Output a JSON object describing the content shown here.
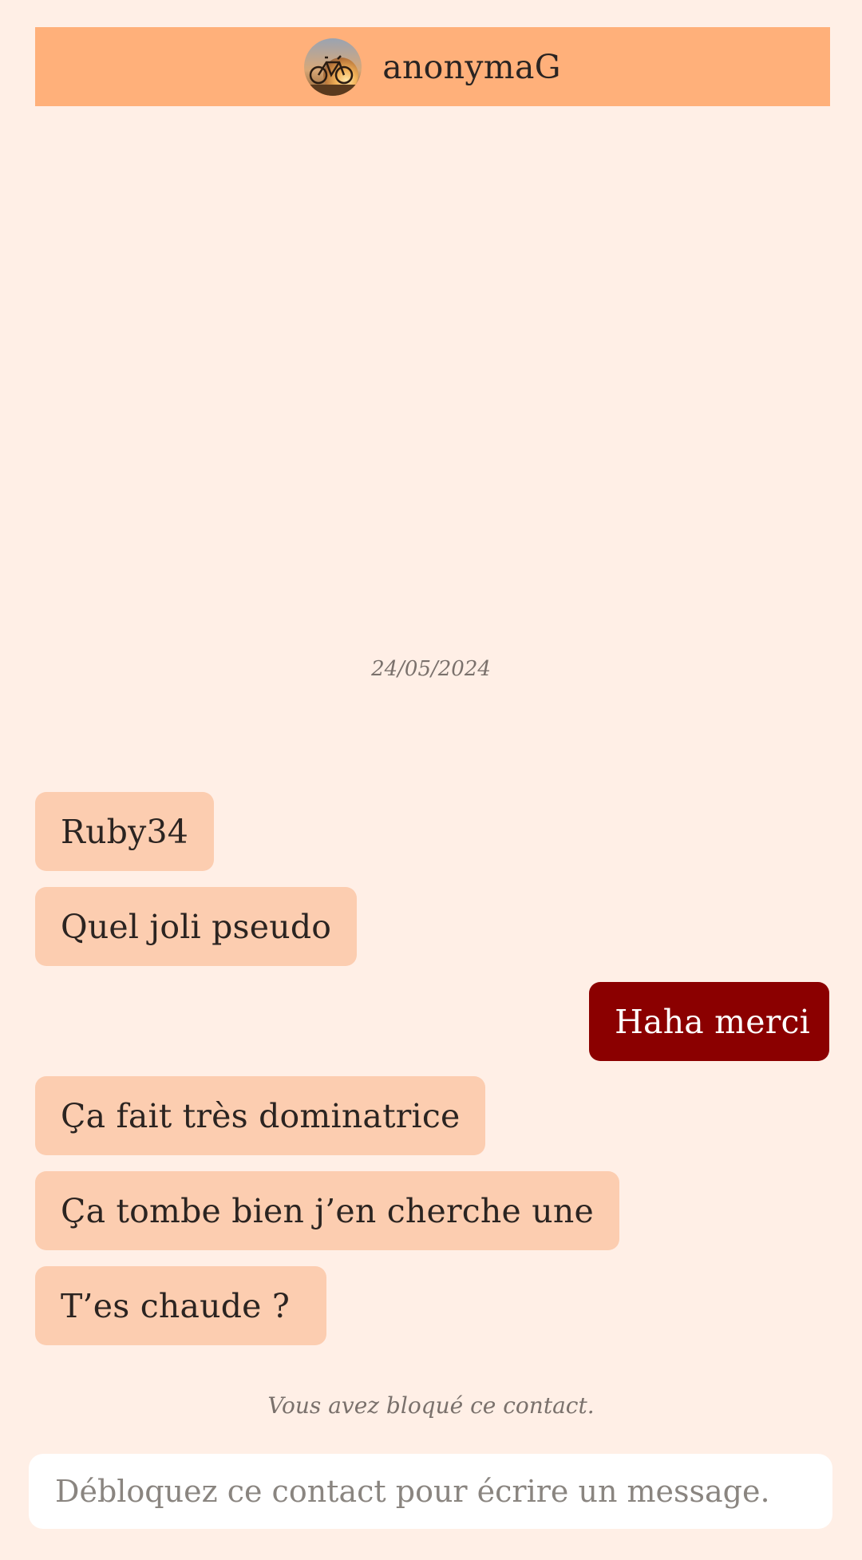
{
  "header": {
    "contact_name": "anonymaG",
    "avatar_icon": "bicycle-sunset-avatar"
  },
  "conversation": {
    "date": "24/05/2024",
    "messages": [
      {
        "direction": "incoming",
        "text": "Ruby34"
      },
      {
        "direction": "incoming",
        "text": "Quel joli pseudo"
      },
      {
        "direction": "outgoing",
        "text": "Haha merci"
      },
      {
        "direction": "incoming",
        "text": "Ça fait très dominatrice"
      },
      {
        "direction": "incoming",
        "text": "Ça tombe bien j’en cherche une"
      },
      {
        "direction": "incoming",
        "text": "T’es chaude ?"
      }
    ],
    "blocked_note": "Vous avez bloqué ce contact."
  },
  "composer": {
    "placeholder": "Débloquez ce contact pour écrire un message."
  },
  "colors": {
    "background": "#ffefe6",
    "header": "#ffb07a",
    "incoming_bubble": "#fccdb0",
    "outgoing_bubble": "#8b0000"
  }
}
